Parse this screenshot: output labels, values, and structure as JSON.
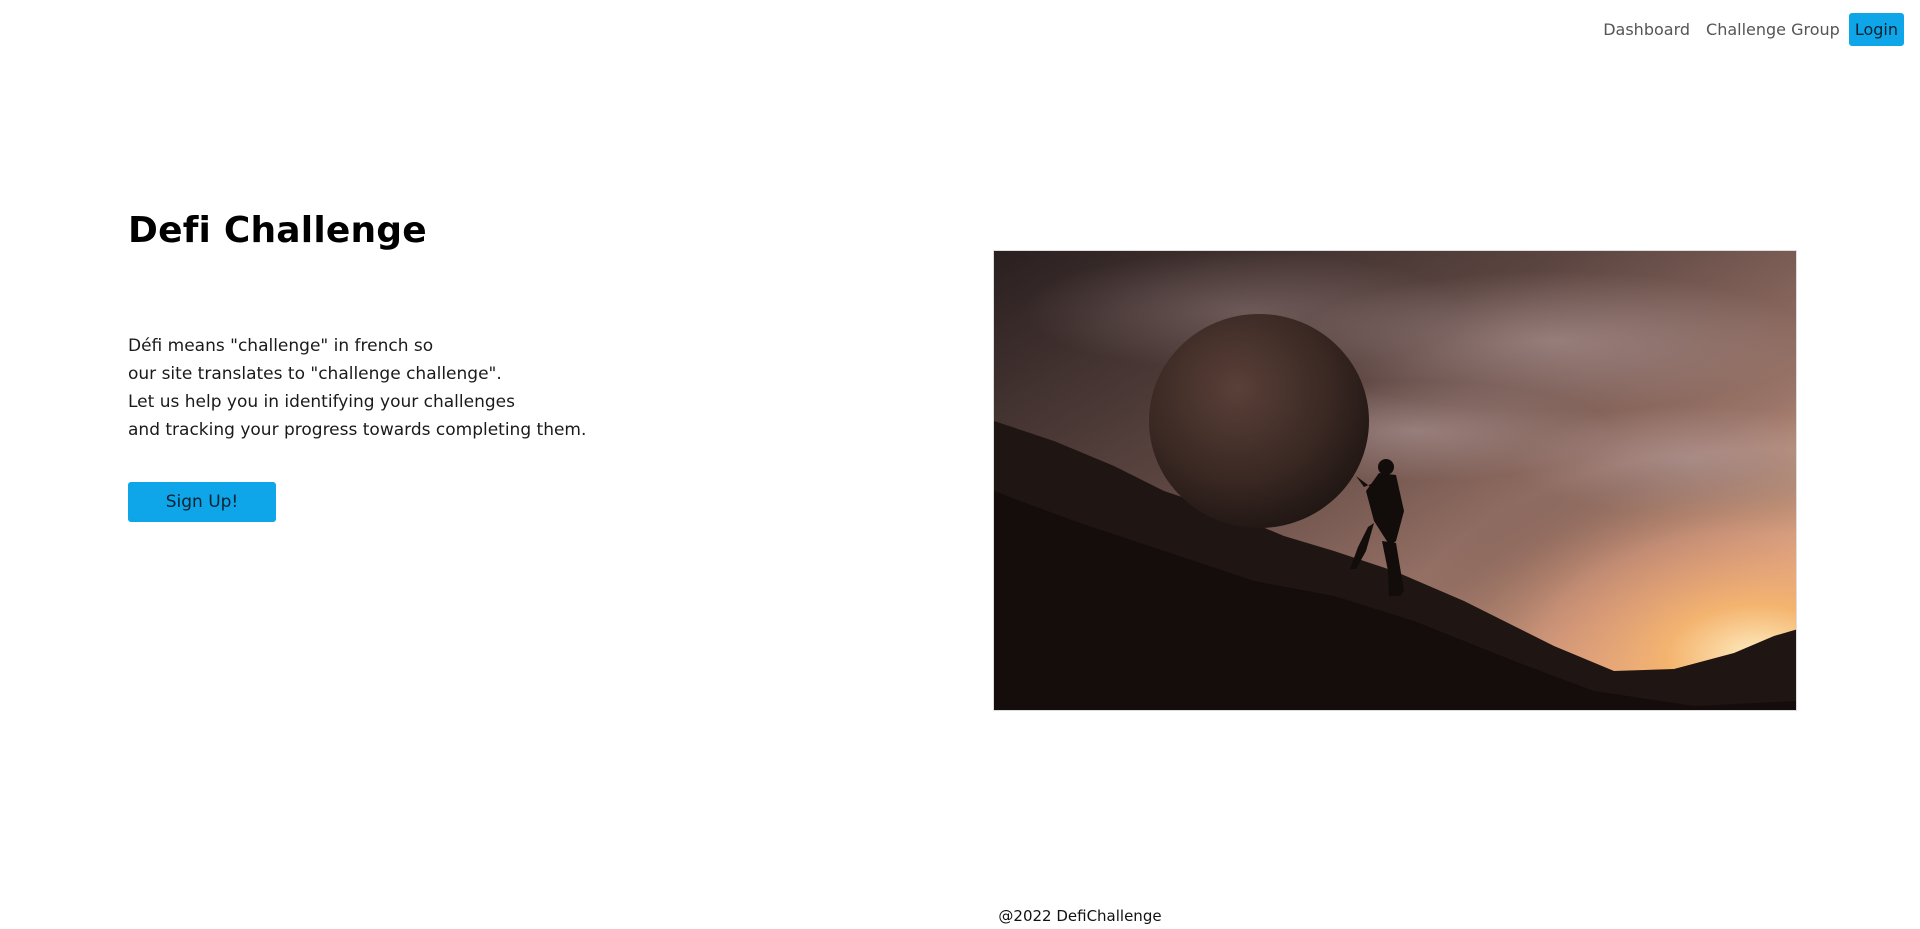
{
  "nav": {
    "links": [
      {
        "label": "Dashboard"
      },
      {
        "label": "Challenge Group"
      }
    ],
    "login_label": "Login"
  },
  "hero": {
    "title": "Defi Challenge",
    "description_lines": [
      "Défi means \"challenge\" in french so",
      "our site translates to \"challenge challenge\".",
      "Let us help you in identifying your challenges",
      "and tracking your progress towards completing them."
    ],
    "signup_label": "Sign Up!",
    "image_icon": "sisyphus-boulder-sunset-photo"
  },
  "footer": {
    "text": "@2022 DefiChallenge"
  },
  "colors": {
    "accent": "#0ea5e9",
    "background": "#ffffff"
  }
}
